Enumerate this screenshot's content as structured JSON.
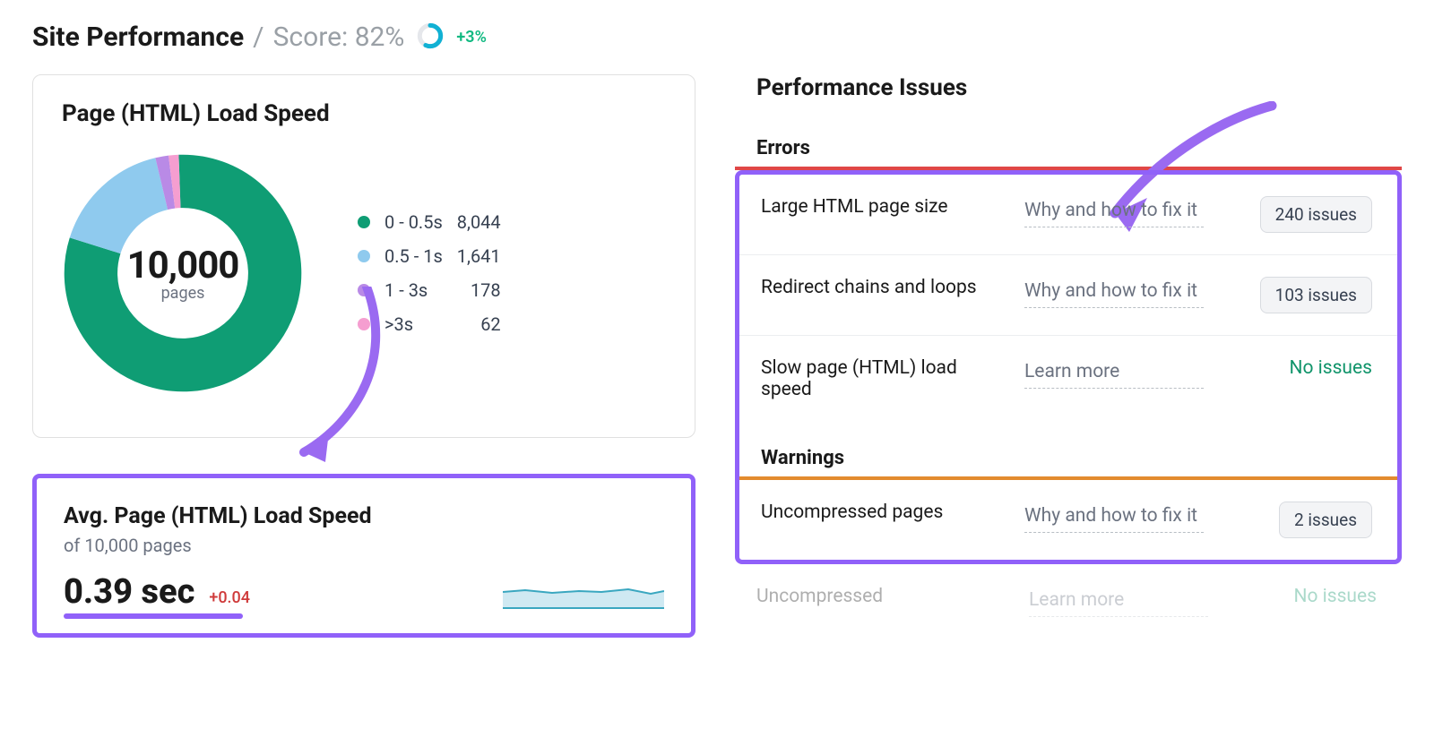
{
  "header": {
    "title": "Site Performance",
    "separator": "/",
    "score_label": "Score: 82%",
    "delta": "+3%"
  },
  "load_speed_panel": {
    "title": "Page (HTML) Load Speed",
    "center_value": "10,000",
    "center_label": "pages",
    "legend": [
      {
        "label": "0 - 0.5s",
        "value": "8,044",
        "color": "#0f9d74"
      },
      {
        "label": "0.5 - 1s",
        "value": "1,641",
        "color": "#8fcaee"
      },
      {
        "label": "1 - 3s",
        "value": "178",
        "color": "#b98ae6"
      },
      {
        "label": ">3s",
        "value": "62",
        "color": "#f59ed0"
      }
    ]
  },
  "avg_panel": {
    "title": "Avg. Page (HTML) Load Speed",
    "subtitle": "of 10,000 pages",
    "value": "0.39 sec",
    "delta": "+0.04"
  },
  "issues_panel": {
    "title": "Performance Issues",
    "errors_label": "Errors",
    "warnings_label": "Warnings",
    "link_fix": "Why and how to fix it",
    "link_learn": "Learn more",
    "errors": [
      {
        "name": "Large HTML page size",
        "link": "fix",
        "count": "240 issues"
      },
      {
        "name": "Redirect chains and loops",
        "link": "fix",
        "count": "103 issues"
      },
      {
        "name": "Slow page (HTML) load speed",
        "link": "learn",
        "count": "No issues"
      }
    ],
    "warnings": [
      {
        "name": "Uncompressed pages",
        "link": "fix",
        "count": "2 issues"
      },
      {
        "name": "Uncompressed",
        "link": "learn",
        "count": "No issues"
      }
    ]
  },
  "chart_data": {
    "type": "pie",
    "title": "Page (HTML) Load Speed",
    "categories": [
      "0 - 0.5s",
      "0.5 - 1s",
      "1 - 3s",
      ">3s"
    ],
    "values": [
      8044,
      1641,
      178,
      62
    ],
    "total": 10000
  },
  "colors": {
    "purple": "#9061f9",
    "green": "#10946a",
    "teal": "#11b1d4",
    "red": "#e04747",
    "orange": "#e38b2e"
  }
}
